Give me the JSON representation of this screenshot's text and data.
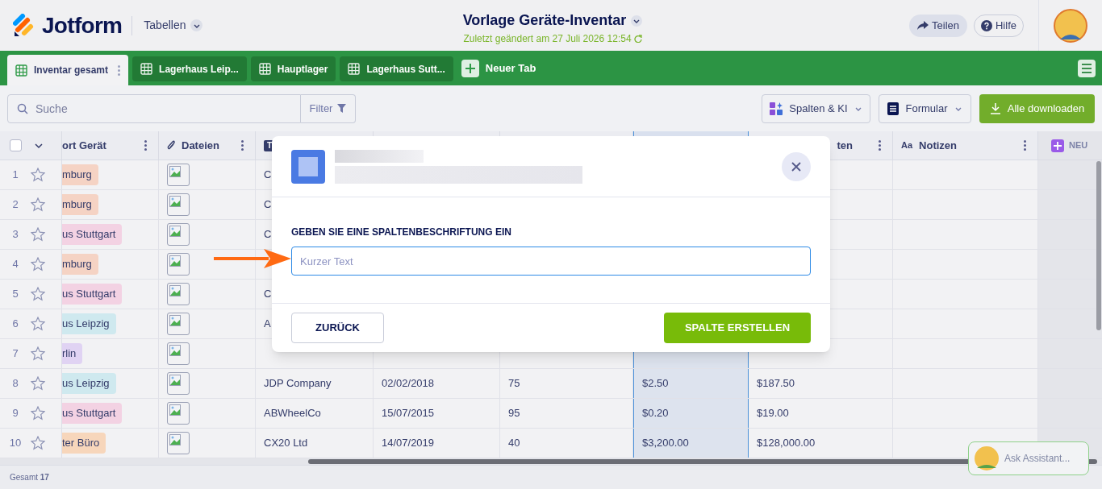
{
  "header": {
    "logo": "Jotform",
    "section": "Tabellen",
    "title": "Vorlage Geräte-Inventar",
    "subtitle": "Zuletzt geändert am 27 Juli 2026 12:54",
    "share": "Teilen",
    "help": "Hilfe"
  },
  "tabs": [
    {
      "label": "Inventar gesamt",
      "selected": true
    },
    {
      "label": "Lagerhaus Leip...",
      "selected": false
    },
    {
      "label": "Hauptlager",
      "selected": false
    },
    {
      "label": "Lagerhaus Sutt...",
      "selected": false
    }
  ],
  "new_tab": "Neuer Tab",
  "toolbar": {
    "search_placeholder": "Suche",
    "filter": "Filter",
    "columns_ai": "Spalten & KI",
    "form": "Formular",
    "download": "Alle downloaden"
  },
  "table": {
    "select_all_checked": false,
    "columns": [
      {
        "label": "ort Gerät",
        "kind": "tag",
        "selected": false
      },
      {
        "label": "Dateien",
        "kind": "files",
        "selected": false
      },
      {
        "type_label": "T",
        "kind": "text",
        "selected": false
      },
      {
        "kind": "text",
        "selected": false
      },
      {
        "kind": "text",
        "selected": false
      },
      {
        "kind": "text",
        "selected": true
      },
      {
        "label": "ten",
        "kind": "text",
        "selected": false
      },
      {
        "label": "Notizen",
        "type_label": "Aa",
        "kind": "text",
        "selected": false
      }
    ],
    "add_column": "NEU",
    "rows": [
      {
        "number": "1",
        "starred": false,
        "color": "#f5d3c4",
        "cells": [
          "mburg",
          "",
          "C"
        ]
      },
      {
        "number": "2",
        "starred": false,
        "color": "#f5d3c4",
        "cells": [
          "mburg",
          "",
          "C"
        ]
      },
      {
        "number": "3",
        "starred": false,
        "color": "#f3d2e3",
        "cells": [
          "us Stuttgart",
          "",
          "C"
        ]
      },
      {
        "number": "4",
        "starred": false,
        "color": "#f5d3c4",
        "cells": [
          "mburg",
          ""
        ]
      },
      {
        "number": "5",
        "starred": false,
        "color": "#f3d2e3",
        "cells": [
          "us Stuttgart",
          "",
          "C"
        ]
      },
      {
        "number": "6",
        "starred": false,
        "color": "#cfe9ef",
        "cells": [
          "us Leipzig",
          "",
          "A"
        ]
      },
      {
        "number": "7",
        "starred": false,
        "color": "#e0d3f3",
        "cells": [
          "rlin",
          ""
        ]
      },
      {
        "number": "8",
        "starred": false,
        "color": "#cfe9ef",
        "cells": [
          "us Leipzig",
          "",
          "JDP Company",
          "02/02/2018",
          "75",
          "$2.50",
          "$187.50"
        ]
      },
      {
        "number": "9",
        "starred": false,
        "color": "#f3d2e3",
        "cells": [
          "us Stuttgart",
          "",
          "ABWheelCo",
          "15/07/2015",
          "95",
          "$0.20",
          "$19.00"
        ]
      },
      {
        "number": "10",
        "starred": false,
        "color": "#f7d6bb",
        "cells": [
          "ter Büro",
          "",
          "CX20 Ltd",
          "14/07/2019",
          "40",
          "$3,200.00",
          "$128,000.00"
        ]
      }
    ]
  },
  "footer": {
    "label": "Gesamt",
    "count": "17"
  },
  "assistant": "Ask Assistant...",
  "dialog": {
    "field_label": "GEBEN SIE EINE SPALTENBESCHRIFTUNG EIN",
    "placeholder": "Kurzer Text",
    "back": "ZURÜCK",
    "create": "SPALTE ERSTELLEN"
  }
}
